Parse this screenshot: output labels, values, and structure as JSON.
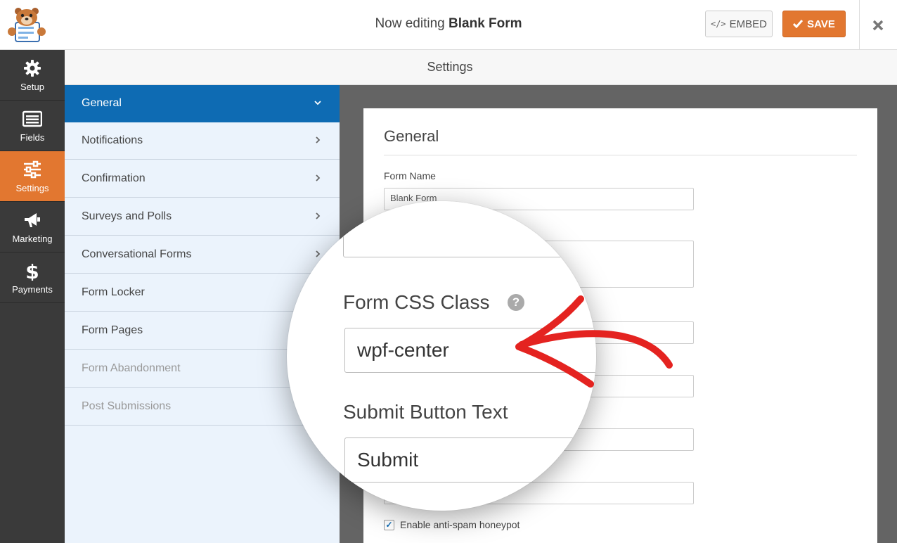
{
  "header": {
    "title_prefix": "Now editing",
    "form_name": "Blank Form",
    "embed_label": "EMBED",
    "embed_icon": "code-icon",
    "save_label": "SAVE",
    "save_icon": "checkmark-icon",
    "close_icon": "close-icon"
  },
  "sidebar": {
    "items": [
      {
        "label": "Setup",
        "icon": "gear-icon"
      },
      {
        "label": "Fields",
        "icon": "fields-list-icon"
      },
      {
        "label": "Settings",
        "icon": "sliders-icon",
        "active": true
      },
      {
        "label": "Marketing",
        "icon": "megaphone-icon"
      },
      {
        "label": "Payments",
        "icon": "dollar-icon"
      }
    ]
  },
  "settings_bar": {
    "title": "Settings"
  },
  "panel": {
    "items": [
      {
        "label": "General",
        "active": true
      },
      {
        "label": "Notifications"
      },
      {
        "label": "Confirmation"
      },
      {
        "label": "Surveys and Polls"
      },
      {
        "label": "Conversational Forms"
      },
      {
        "label": "Form Locker"
      },
      {
        "label": "Form Pages"
      },
      {
        "label": "Form Abandonment",
        "disabled": true
      },
      {
        "label": "Post Submissions",
        "disabled": true
      }
    ]
  },
  "general": {
    "title": "General",
    "form_name_label": "Form Name",
    "form_name_value": "Blank Form",
    "honeypot_label": "Enable anti-spam honeypot",
    "honeypot_checked": true
  },
  "magnifier": {
    "css_class_label": "Form CSS Class",
    "css_class_value": "wpf-center",
    "submit_label": "Submit Button Text",
    "submit_value": "Submit",
    "help_icon": "question-icon"
  },
  "colors": {
    "accent_orange": "#e27730",
    "active_blue": "#0e6bb3",
    "sidebar_dark": "#3a3a3a",
    "panel_bg": "#ebf3fc",
    "arrow_red": "#e42320"
  }
}
